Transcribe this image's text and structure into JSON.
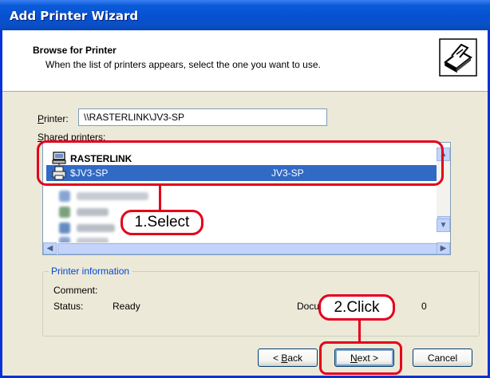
{
  "window": {
    "title": "Add Printer Wizard"
  },
  "header": {
    "title": "Browse for Printer",
    "subtitle": "When the list of printers appears, select the one you want to use.",
    "icon": "printer-wizard-icon"
  },
  "printer_field": {
    "label_mnemonic": "P",
    "label_rest": "rinter:",
    "value": "\\\\RASTERLINK\\JV3-SP"
  },
  "shared_printers": {
    "label_mnemonic": "S",
    "label_rest": "hared printers:",
    "group": {
      "name": "RASTERLINK",
      "icon": "network-printer-icon"
    },
    "selected": {
      "name": "$JV3-SP",
      "model": "JV3-SP",
      "icon": "printer-icon"
    }
  },
  "printer_info": {
    "title": "Printer information",
    "comment_label": "Comment:",
    "status_label": "Status:",
    "status_value": "Ready",
    "documents_label": "Docu",
    "documents_value": "0"
  },
  "buttons": {
    "back_mnemonic": "B",
    "back_rest": "ack",
    "back_prefix": "< ",
    "next_mnemonic": "N",
    "next_rest": "ext >",
    "cancel": "Cancel"
  },
  "annotations": {
    "select": "1.Select",
    "click": "2.Click",
    "color": "#e3001b"
  }
}
